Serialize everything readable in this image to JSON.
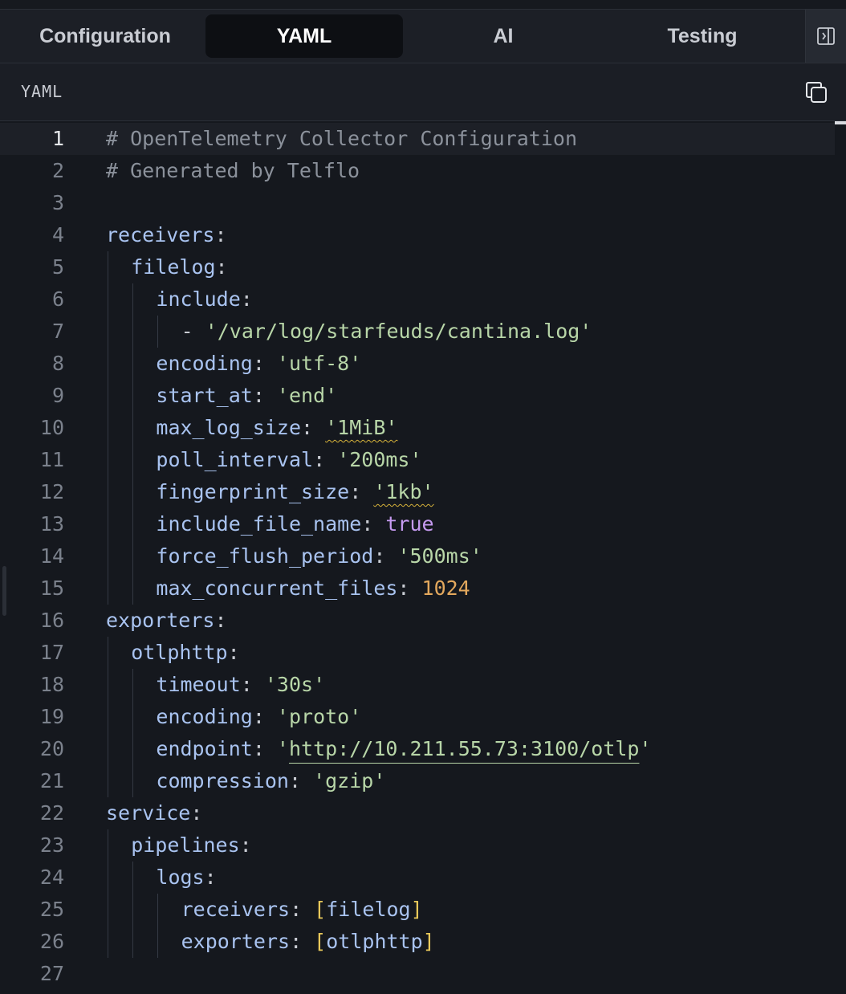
{
  "tabs": [
    {
      "label": "Configuration",
      "active": false
    },
    {
      "label": "YAML",
      "active": true
    },
    {
      "label": "AI",
      "active": false
    },
    {
      "label": "Testing",
      "active": false
    }
  ],
  "icons": {
    "collapse": "sidebar-collapse-icon",
    "copy": "copy-icon"
  },
  "panel": {
    "title": "YAML"
  },
  "colors": {
    "comment": "#8b919b",
    "key": "#a9c3f0",
    "string": "#b8d6a8",
    "boolean": "#c59af0",
    "number": "#e3a85d",
    "bracket": "#e8c85a",
    "warning_squiggle": "#d6b23a"
  },
  "editor": {
    "current_line": 1,
    "lines": [
      {
        "n": "1",
        "indent": 0,
        "tokens": [
          {
            "t": "comment",
            "v": "# OpenTelemetry Collector Configuration"
          }
        ]
      },
      {
        "n": "2",
        "indent": 0,
        "tokens": [
          {
            "t": "comment",
            "v": "# Generated by Telflo"
          }
        ]
      },
      {
        "n": "3",
        "indent": 0,
        "tokens": []
      },
      {
        "n": "4",
        "indent": 0,
        "tokens": [
          {
            "t": "key",
            "v": "receivers"
          },
          {
            "t": "punct",
            "v": ":"
          }
        ]
      },
      {
        "n": "5",
        "indent": 1,
        "tokens": [
          {
            "t": "key",
            "v": "filelog"
          },
          {
            "t": "punct",
            "v": ":"
          }
        ]
      },
      {
        "n": "6",
        "indent": 2,
        "tokens": [
          {
            "t": "key",
            "v": "include"
          },
          {
            "t": "punct",
            "v": ":"
          }
        ]
      },
      {
        "n": "7",
        "indent": 3,
        "tokens": [
          {
            "t": "punct",
            "v": "- "
          },
          {
            "t": "str",
            "v": "'/var/log/starfeuds/cantina.log'"
          }
        ]
      },
      {
        "n": "8",
        "indent": 2,
        "tokens": [
          {
            "t": "key",
            "v": "encoding"
          },
          {
            "t": "punct",
            "v": ": "
          },
          {
            "t": "str",
            "v": "'utf-8'"
          }
        ]
      },
      {
        "n": "9",
        "indent": 2,
        "tokens": [
          {
            "t": "key",
            "v": "start_at"
          },
          {
            "t": "punct",
            "v": ": "
          },
          {
            "t": "str",
            "v": "'end'"
          }
        ]
      },
      {
        "n": "10",
        "indent": 2,
        "tokens": [
          {
            "t": "key",
            "v": "max_log_size"
          },
          {
            "t": "punct",
            "v": ": "
          },
          {
            "t": "str",
            "v": "'1MiB'",
            "warn": true
          }
        ]
      },
      {
        "n": "11",
        "indent": 2,
        "tokens": [
          {
            "t": "key",
            "v": "poll_interval"
          },
          {
            "t": "punct",
            "v": ": "
          },
          {
            "t": "str",
            "v": "'200ms'"
          }
        ]
      },
      {
        "n": "12",
        "indent": 2,
        "tokens": [
          {
            "t": "key",
            "v": "fingerprint_size"
          },
          {
            "t": "punct",
            "v": ": "
          },
          {
            "t": "str",
            "v": "'1kb'",
            "warn": true
          }
        ]
      },
      {
        "n": "13",
        "indent": 2,
        "tokens": [
          {
            "t": "key",
            "v": "include_file_name"
          },
          {
            "t": "punct",
            "v": ": "
          },
          {
            "t": "bool",
            "v": "true"
          }
        ]
      },
      {
        "n": "14",
        "indent": 2,
        "tokens": [
          {
            "t": "key",
            "v": "force_flush_period"
          },
          {
            "t": "punct",
            "v": ": "
          },
          {
            "t": "str",
            "v": "'500ms'"
          }
        ]
      },
      {
        "n": "15",
        "indent": 2,
        "tokens": [
          {
            "t": "key",
            "v": "max_concurrent_files"
          },
          {
            "t": "punct",
            "v": ": "
          },
          {
            "t": "num",
            "v": "1024"
          }
        ]
      },
      {
        "n": "16",
        "indent": 0,
        "tokens": [
          {
            "t": "key",
            "v": "exporters"
          },
          {
            "t": "punct",
            "v": ":"
          }
        ]
      },
      {
        "n": "17",
        "indent": 1,
        "tokens": [
          {
            "t": "key",
            "v": "otlphttp"
          },
          {
            "t": "punct",
            "v": ":"
          }
        ]
      },
      {
        "n": "18",
        "indent": 2,
        "tokens": [
          {
            "t": "key",
            "v": "timeout"
          },
          {
            "t": "punct",
            "v": ": "
          },
          {
            "t": "str",
            "v": "'30s'"
          }
        ]
      },
      {
        "n": "19",
        "indent": 2,
        "tokens": [
          {
            "t": "key",
            "v": "encoding"
          },
          {
            "t": "punct",
            "v": ": "
          },
          {
            "t": "str",
            "v": "'proto'"
          }
        ]
      },
      {
        "n": "20",
        "indent": 2,
        "tokens": [
          {
            "t": "key",
            "v": "endpoint"
          },
          {
            "t": "punct",
            "v": ": "
          },
          {
            "t": "str",
            "v": "'"
          },
          {
            "t": "str",
            "v": "http://10.211.55.73:3100/otlp",
            "link": true
          },
          {
            "t": "str",
            "v": "'"
          }
        ]
      },
      {
        "n": "21",
        "indent": 2,
        "tokens": [
          {
            "t": "key",
            "v": "compression"
          },
          {
            "t": "punct",
            "v": ": "
          },
          {
            "t": "str",
            "v": "'gzip'"
          }
        ]
      },
      {
        "n": "22",
        "indent": 0,
        "tokens": [
          {
            "t": "key",
            "v": "service"
          },
          {
            "t": "punct",
            "v": ":"
          }
        ]
      },
      {
        "n": "23",
        "indent": 1,
        "tokens": [
          {
            "t": "key",
            "v": "pipelines"
          },
          {
            "t": "punct",
            "v": ":"
          }
        ]
      },
      {
        "n": "24",
        "indent": 2,
        "tokens": [
          {
            "t": "key",
            "v": "logs"
          },
          {
            "t": "punct",
            "v": ":"
          }
        ]
      },
      {
        "n": "25",
        "indent": 3,
        "tokens": [
          {
            "t": "key",
            "v": "receivers"
          },
          {
            "t": "punct",
            "v": ": "
          },
          {
            "t": "bracket",
            "v": "["
          },
          {
            "t": "key",
            "v": "filelog"
          },
          {
            "t": "bracket",
            "v": "]"
          }
        ]
      },
      {
        "n": "26",
        "indent": 3,
        "tokens": [
          {
            "t": "key",
            "v": "exporters"
          },
          {
            "t": "punct",
            "v": ": "
          },
          {
            "t": "bracket",
            "v": "["
          },
          {
            "t": "key",
            "v": "otlphttp"
          },
          {
            "t": "bracket",
            "v": "]"
          }
        ]
      },
      {
        "n": "27",
        "indent": 0,
        "tokens": []
      }
    ]
  }
}
